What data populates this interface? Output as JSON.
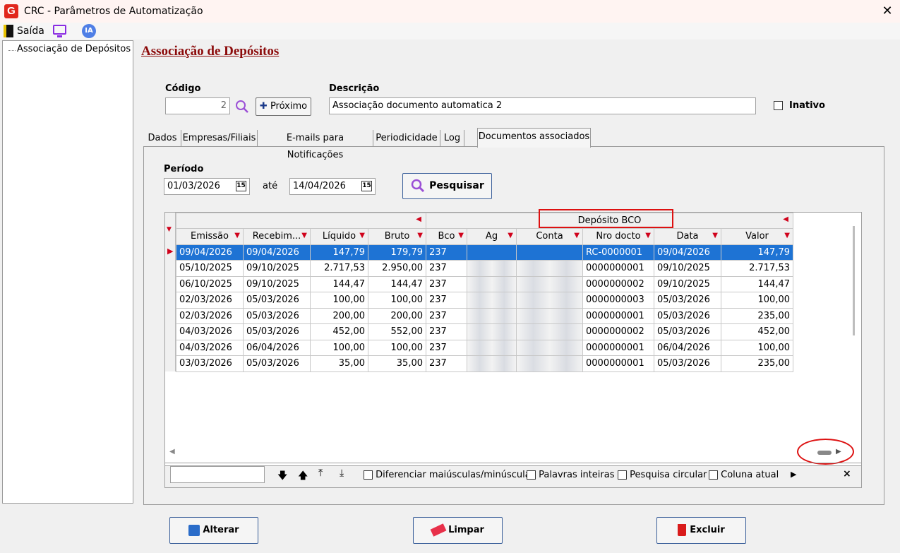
{
  "window": {
    "title": "CRC - Parâmetros de Automatização",
    "close": "✕"
  },
  "menu": {
    "saida": "Saída",
    "ia": "IA"
  },
  "tree": {
    "item": "Associação de Depósitos"
  },
  "page": {
    "title": "Associação de Depósitos"
  },
  "form": {
    "codigo_label": "Código",
    "codigo_value": "2",
    "proximo_label": "Próximo",
    "descricao_label": "Descrição",
    "descricao_value": "Associação documento automatica 2",
    "inativo_label": "Inativo"
  },
  "tabs": [
    "Dados",
    "Empresas/Filiais",
    "E-mails para Notificações",
    "Periodicidade",
    "Log",
    "Documentos associados"
  ],
  "periodo": {
    "label": "Período",
    "start": "01/03/2026",
    "ate": "até",
    "end": "14/04/2026",
    "cal_icon": "15",
    "pesquisar": "Pesquisar"
  },
  "grid": {
    "band_label": "Depósito BCO",
    "columns": [
      "Emissão",
      "Recebim...",
      "Líquido",
      "Bruto",
      "Bco",
      "Ag",
      "Conta",
      "Nro docto",
      "Data",
      "Valor"
    ],
    "rows": [
      [
        "09/04/2026",
        "09/04/2026",
        "147,79",
        "179,79",
        "237",
        "",
        "",
        "RC-0000001",
        "09/04/2026",
        "147,79"
      ],
      [
        "05/10/2025",
        "09/10/2025",
        "2.717,53",
        "2.950,00",
        "237",
        "",
        "",
        "0000000001",
        "09/10/2025",
        "2.717,53"
      ],
      [
        "06/10/2025",
        "09/10/2025",
        "144,47",
        "144,47",
        "237",
        "",
        "",
        "0000000002",
        "09/10/2025",
        "144,47"
      ],
      [
        "02/03/2026",
        "05/03/2026",
        "100,00",
        "100,00",
        "237",
        "",
        "",
        "0000000003",
        "05/03/2026",
        "100,00"
      ],
      [
        "02/03/2026",
        "05/03/2026",
        "200,00",
        "200,00",
        "237",
        "",
        "",
        "0000000001",
        "05/03/2026",
        "235,00"
      ],
      [
        "04/03/2026",
        "05/03/2026",
        "452,00",
        "552,00",
        "237",
        "",
        "",
        "0000000002",
        "05/03/2026",
        "452,00"
      ],
      [
        "04/03/2026",
        "06/04/2026",
        "100,00",
        "100,00",
        "237",
        "",
        "",
        "0000000001",
        "06/04/2026",
        "100,00"
      ],
      [
        "03/03/2026",
        "05/03/2026",
        "35,00",
        "35,00",
        "237",
        "",
        "",
        "0000000001",
        "05/03/2026",
        "235,00"
      ]
    ]
  },
  "search": {
    "diferenciar": "Diferenciar maiúsculas/minúsculas",
    "palavras": "Palavras inteiras",
    "circular": "Pesquisa circular",
    "coluna": "Coluna atual"
  },
  "buttons": {
    "alterar": "Alterar",
    "limpar": "Limpar",
    "excluir": "Excluir"
  },
  "colors": {
    "accent": "#8b0a0a",
    "selection": "#1e73d4",
    "highlight": "#d11111"
  }
}
